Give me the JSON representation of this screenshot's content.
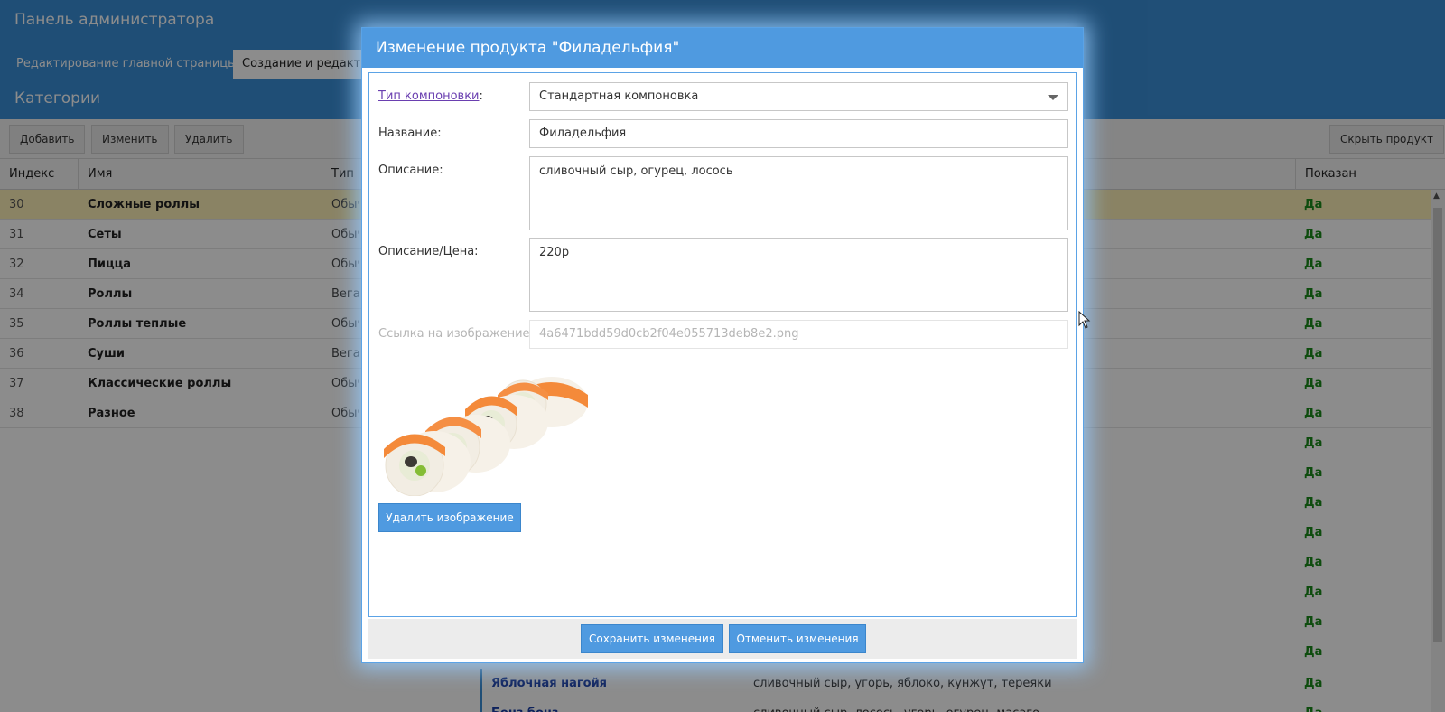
{
  "admin": {
    "title": "Панель администратора",
    "tabs": [
      "Редактирование главной страницы",
      "Создание и редактир"
    ],
    "section_title": "Категории",
    "toolbar": {
      "add": "Добавить",
      "edit": "Изменить",
      "delete": "Удалить",
      "hide_product": "Скрыть продукт"
    },
    "columns": {
      "index": "Индекс",
      "name": "Имя",
      "type": "Тип",
      "shown": "Показан"
    },
    "categories": [
      {
        "index": "30",
        "name": "Сложные роллы",
        "type": "Обыч",
        "shown": "Да"
      },
      {
        "index": "31",
        "name": "Сеты",
        "type": "Обыч",
        "shown": "Да"
      },
      {
        "index": "32",
        "name": "Пицца",
        "type": "Обыч",
        "shown": "Да"
      },
      {
        "index": "34",
        "name": "Роллы",
        "type": "Веган",
        "shown": "Да"
      },
      {
        "index": "35",
        "name": "Роллы теплые",
        "type": "Обыч",
        "shown": "Да"
      },
      {
        "index": "36",
        "name": "Суши",
        "type": "Веган",
        "shown": "Да"
      },
      {
        "index": "37",
        "name": "Классические роллы",
        "type": "Обыч",
        "shown": "Да"
      },
      {
        "index": "38",
        "name": "Разное",
        "type": "Обыч",
        "shown": "Да"
      }
    ],
    "extra_shown": [
      "Да",
      "Да",
      "Да",
      "Да",
      "Да",
      "Да",
      "Да",
      "Да",
      "Да"
    ],
    "products": [
      {
        "name": "Яблочная нагойя",
        "description": "сливочный сыр, угорь, яблоко, кунжут, тереяки",
        "shown": "Да"
      },
      {
        "name": "Бонз бонз",
        "description": "сливочный сыр, лосось, угорь, огурец, масаго",
        "shown": "Да"
      }
    ]
  },
  "modal": {
    "title": "Изменение продукта \"Филадельфия\"",
    "layout_label": "Тип компоновки",
    "layout_label_suffix": ":",
    "layout_value": "Стандартная компоновка",
    "name_label": "Название:",
    "name_value": "Филадельфия",
    "description_label": "Описание:",
    "description_value": "сливочный сыр, огурец, лосось",
    "price_label": "Описание/Цена:",
    "price_value": "220р",
    "image_link_label": "Ссылка на изображение:",
    "image_link_value": "4a6471bdd59d0cb2f04e055713deb8e2.png",
    "delete_image": "Удалить изображение",
    "save": "Сохранить изменения",
    "cancel": "Отменить изменения"
  },
  "colors": {
    "accent": "#4f9ae0",
    "shown_green": "#1a8a1a",
    "selected_row": "#fbeeb6",
    "product_link": "#1a3fa8"
  }
}
